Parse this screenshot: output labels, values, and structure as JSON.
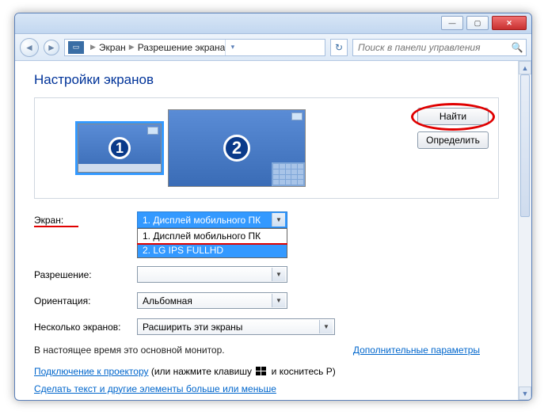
{
  "titlebar": {
    "minimize": "—",
    "maximize": "▢",
    "close": "✕"
  },
  "nav": {
    "crumb1": "Экран",
    "crumb2": "Разрешение экрана",
    "refresh": "↻",
    "search_placeholder": "Поиск в панели управления"
  },
  "page_title": "Настройки экранов",
  "monitors": {
    "mon1_num": "1",
    "mon2_num": "2",
    "find_btn": "Найти",
    "identify_btn": "Определить"
  },
  "labels": {
    "screen": "Экран:",
    "resolution": "Разрешение:",
    "orientation": "Ориентация:",
    "multi": "Несколько экранов:"
  },
  "values": {
    "screen_selected": "1. Дисплей мобильного ПК",
    "screen_opt1": "1. Дисплей мобильного ПК",
    "screen_opt2": "2. LG IPS FULLHD",
    "resolution": "",
    "orientation": "Альбомная",
    "multi": "Расширить эти экраны"
  },
  "info": {
    "primary": "В настоящее время это основной монитор.",
    "advanced": "Дополнительные параметры"
  },
  "links": {
    "projector_a": "Подключение к проектору",
    "projector_b": " (или нажмите клавишу ",
    "projector_c": " и коснитесь P)",
    "textsize": "Сделать текст и другие элементы больше или меньше"
  }
}
